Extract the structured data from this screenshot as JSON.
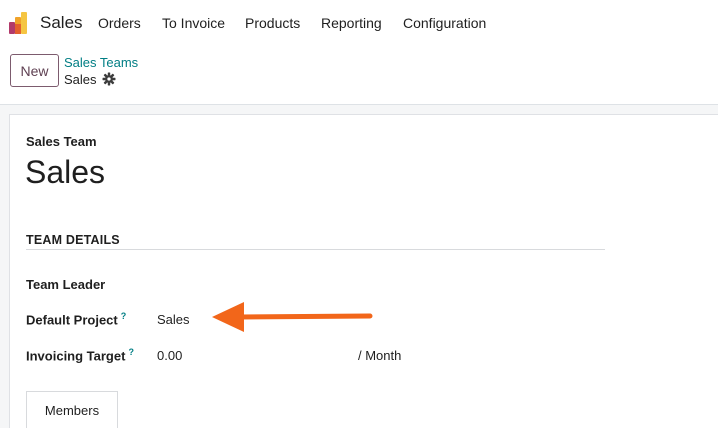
{
  "app": {
    "name": "Sales",
    "menu": [
      "Orders",
      "To Invoice",
      "Products",
      "Reporting",
      "Configuration"
    ]
  },
  "control_panel": {
    "new_label": "New",
    "breadcrumb_parent": "Sales Teams",
    "breadcrumb_current": "Sales",
    "gear_icon": "gear-icon"
  },
  "form": {
    "record_label": "Sales Team",
    "record_title": "Sales",
    "section_title": "TEAM DETAILS",
    "fields": {
      "team_leader_label": "Team Leader",
      "default_project_label": "Default Project",
      "default_project_help": "?",
      "default_project_value": "Sales",
      "invoicing_target_label": "Invoicing Target",
      "invoicing_target_help": "?",
      "invoicing_target_value": "0.00",
      "invoicing_target_unit": "/ Month"
    },
    "tabs": [
      "Members"
    ]
  },
  "colors": {
    "accent_teal": "#017e84",
    "brand_purple": "#714b67",
    "arrow_orange": "#f2661a"
  }
}
